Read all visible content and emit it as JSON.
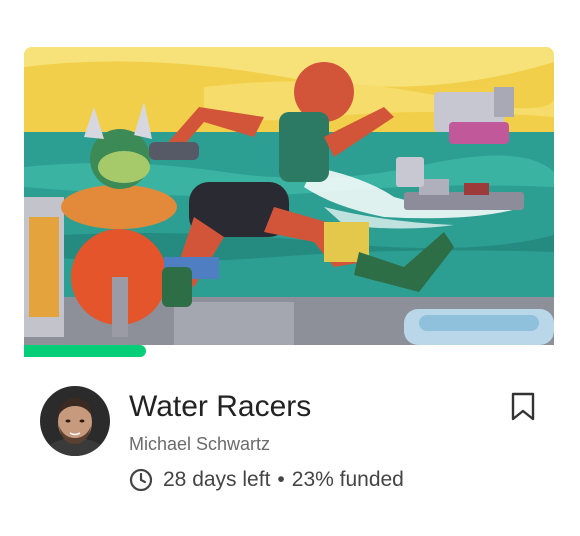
{
  "project": {
    "title": "Water Racers",
    "creator": "Michael Schwartz",
    "days_left": "28 days left",
    "separator": "•",
    "funded": "23% funded",
    "funded_percent": 23
  },
  "icons": {
    "clock": "clock-icon",
    "bookmark": "bookmark-icon"
  },
  "colors": {
    "progress": "#05ce78",
    "text": "#222222",
    "muted": "#6b6b6b"
  }
}
